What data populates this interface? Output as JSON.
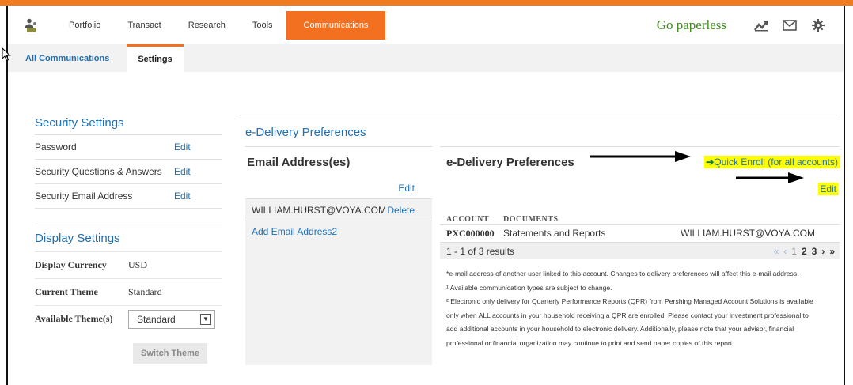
{
  "nav": {
    "items": [
      {
        "label": "Portfolio"
      },
      {
        "label": "Transact"
      },
      {
        "label": "Research"
      },
      {
        "label": "Tools"
      },
      {
        "label": "Communications"
      }
    ],
    "go_paperless": "Go paperless",
    "accent_color": "#f37021"
  },
  "subnav": {
    "items": [
      {
        "label": "All Communications"
      },
      {
        "label": "Settings"
      }
    ]
  },
  "security": {
    "title": "Security Settings",
    "rows": [
      {
        "label": "Password",
        "action": "Edit"
      },
      {
        "label": "Security Questions & Answers",
        "action": "Edit"
      },
      {
        "label": "Security Email Address",
        "action": "Edit"
      }
    ]
  },
  "display": {
    "title": "Display Settings",
    "currency_label": "Display Currency",
    "currency_value": "USD",
    "theme_label": "Current Theme",
    "theme_value": "Standard",
    "available_label": "Available Theme(s)",
    "available_selected": "Standard",
    "switch_button": "Switch Theme"
  },
  "edelivery": {
    "section_title": "e-Delivery Preferences",
    "email_panel": {
      "title": "Email Address(es)",
      "edit": "Edit",
      "email": "WILLIAM.HURST@VOYA.COM",
      "delete": "Delete",
      "add": "Add Email Address2"
    },
    "prefs": {
      "title": "e-Delivery Preferences",
      "quick_enroll": "Quick Enroll (for all accounts)",
      "edit": "Edit",
      "col_account": "ACCOUNT",
      "col_documents": "DOCUMENTS",
      "row": {
        "account": "PXC000000",
        "documents": "Statements and Reports",
        "email": "WILLIAM.HURST@VOYA.COM"
      },
      "results": "1 - 1 of 3 results",
      "pager": {
        "first": "«",
        "prev": "‹",
        "current": "1",
        "page2": "2",
        "page3": "3",
        "next": "›",
        "last": "»"
      },
      "notes": [
        "*e-mail address of another user linked to this account. Changes to delivery preferences will affect this e-mail address.",
        "¹ Available communication types are subject to change.",
        "² Electronic only delivery for Quarterly Performance Reports (QPR) from Pershing Managed Account Solutions is available",
        "only when ALL accounts in your household receiving a QPR are enrolled. Please contact your investment professional to",
        "add additional accounts in your household to electronic delivery. Additionally, please note that your advisor, financial",
        "professional or financial organization may continue to print and send paper copies of this report."
      ]
    }
  }
}
